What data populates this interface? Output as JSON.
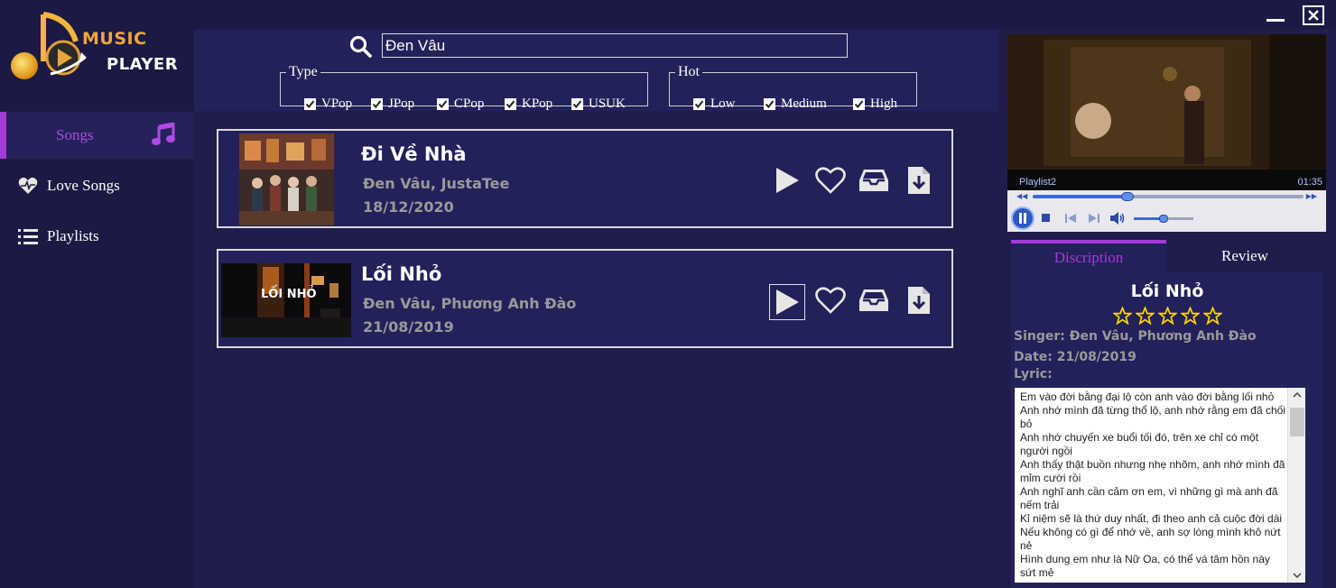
{
  "app": {
    "logo_line1": "MUSIC",
    "logo_line2": "PLAYER"
  },
  "sidebar": {
    "items": [
      {
        "label": "Songs",
        "icon": "music-note-icon",
        "active": true
      },
      {
        "label": "Love Songs",
        "icon": "heart-pulse-icon",
        "active": false
      },
      {
        "label": "Playlists",
        "icon": "list-icon",
        "active": false
      }
    ]
  },
  "window": {
    "minimize_icon": "minimize-icon",
    "close_icon": "close-icon"
  },
  "search": {
    "value": "Đen Vâu",
    "icon": "search-icon"
  },
  "filters": {
    "type": {
      "legend": "Type",
      "options": [
        {
          "label": "VPop",
          "checked": true
        },
        {
          "label": "JPop",
          "checked": true
        },
        {
          "label": "CPop",
          "checked": true
        },
        {
          "label": "KPop",
          "checked": true
        },
        {
          "label": "USUK",
          "checked": true
        }
      ]
    },
    "hot": {
      "legend": "Hot",
      "options": [
        {
          "label": "Low",
          "checked": true
        },
        {
          "label": "Medium",
          "checked": true
        },
        {
          "label": "High",
          "checked": true
        }
      ]
    }
  },
  "songs": [
    {
      "title": "Đi Về Nhà",
      "artist": "Đen Vâu, JustaTee",
      "date": "18/12/2020"
    },
    {
      "title": "Lối Nhỏ",
      "artist": "Đen Vâu, Phương Anh Đào",
      "date": "21/08/2019",
      "thumb_text": "LỐI NHỎ"
    }
  ],
  "player": {
    "playlist": "Playlist2",
    "time": "01:35",
    "progress": 0.35,
    "volume": 0.5
  },
  "tabs": {
    "description": "Discription",
    "review": "Review"
  },
  "detail": {
    "title": "Lối Nhỏ",
    "rating": 0,
    "rating_max": 5,
    "singer": "Singer: Đen Vâu, Phương Anh Đào",
    "date": "Date: 21/08/2019",
    "lyric_label": "Lyric:",
    "lyric": "Em vào đời bằng đại lộ còn anh vào đời bằng lối nhỏ\nAnh nhớ mình đã từng thổ lộ, anh nhớ rằng em đã chối bỏ\nAnh nhớ chuyến xe buổi tối đó, trên xe chỉ có một người ngồi\nAnh thấy thật buồn nhưng nhẹ nhõm, anh nhớ mình đã mỉm cười rồi\nAnh nghĩ anh cần cảm ơn em, vì những gì mà anh đã nếm trải\nKỉ niệm sẽ là thứ duy nhất, đi theo anh cả cuộc đời dài\nNếu không có gì để nhớ về, anh sợ lòng mình khô nứt nẻ\nHình dung em như là Nữ Oa, có thể vá tâm hồn này sứt mẻ"
  },
  "colors": {
    "accent": "#a33bd9",
    "bg": "#1f1d4c",
    "sidebar": "#1c1a44",
    "panel": "#23215a"
  }
}
